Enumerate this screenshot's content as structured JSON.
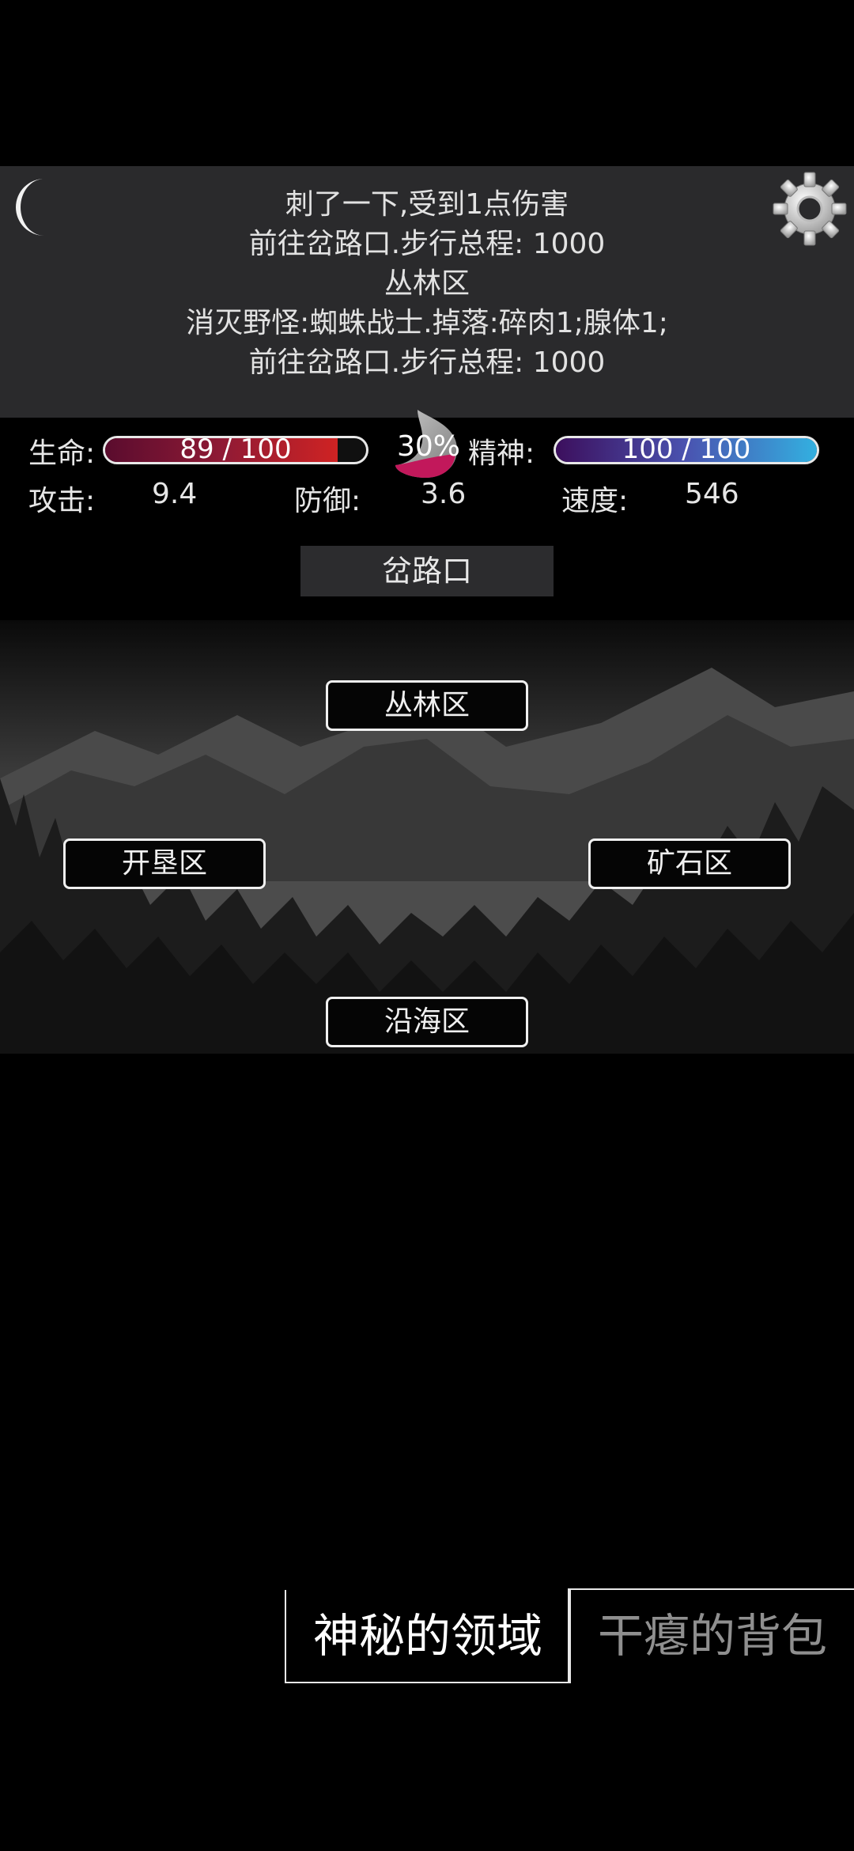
{
  "log": {
    "lines": [
      "刺了一下,受到1点伤害",
      "前往岔路口.步行总程: 1000",
      "丛林区",
      "消灭野怪:蜘蛛战士.掉落:碎肉1;腺体1;",
      "前往岔路口.步行总程: 1000"
    ]
  },
  "stats": {
    "hp_label": "生命:",
    "hp_text": "89 / 100",
    "hp_fraction": 0.89,
    "hunger_text": "30%",
    "hunger_fraction": 0.3,
    "spirit_label": "精神:",
    "spirit_text": "100 / 100",
    "spirit_fraction": 1.0,
    "attack_label": "攻击:",
    "attack_value": "9.4",
    "defense_label": "防御:",
    "defense_value": "3.6",
    "speed_label": "速度:",
    "speed_value": "546"
  },
  "location": {
    "current": "岔路口"
  },
  "map": {
    "north": "丛林区",
    "west": "开垦区",
    "east": "矿石区",
    "south": "沿海区"
  },
  "tabs": {
    "realm": "神秘的领域",
    "bag": "干瘪的背包"
  },
  "colors": {
    "hp": "#cf2323",
    "spirit": "#33b0e0",
    "hunger": "#c2185b"
  },
  "icons": {
    "top_left": "moon-icon",
    "top_right": "gear-icon"
  }
}
